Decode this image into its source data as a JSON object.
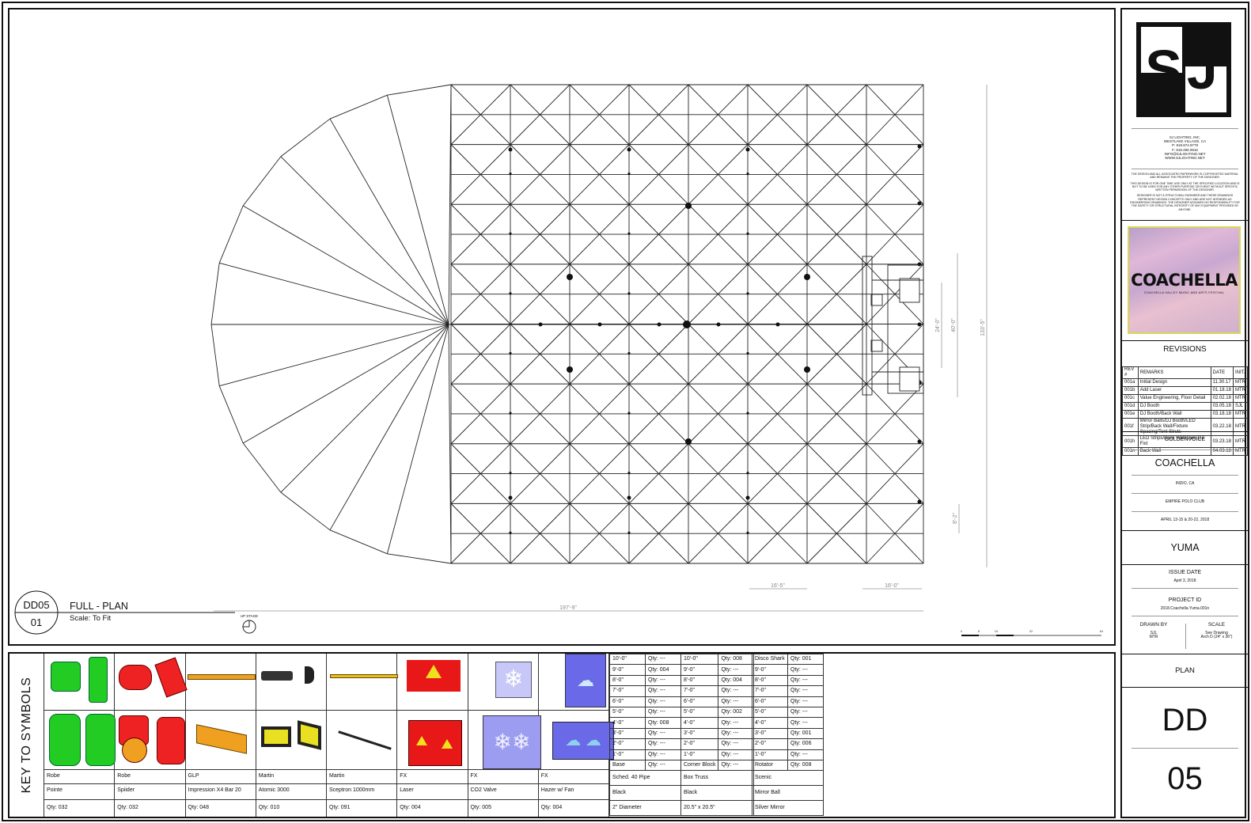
{
  "drawing": {
    "sheet_code": "DD05",
    "sheet_num": "01",
    "view_title": "FULL - PLAN",
    "scale_note": "Scale: To Fit",
    "upstage_label": "UP STAGE",
    "dims": {
      "overall_width": "197'-9\"",
      "overall_depth": "133'-5\"",
      "booth_a": "24'-0\"",
      "booth_b": "40'-0\"",
      "side": "8'-2\"",
      "bottom_a": "16'-5\"",
      "bottom_b": "16'-0\""
    },
    "scale_bar": [
      "0",
      "8",
      "16",
      "32",
      "64"
    ]
  },
  "titleblock": {
    "logo": "SJ",
    "company": [
      "SJ LIGHTING, INC.",
      "WESTLAKE VILLAGE, CA",
      "P: 818.874.9779",
      "F: 818.495.0816",
      "INFO@SJLIGHTING.NET",
      "WWW.SJLIGHTING.NET"
    ],
    "legal": [
      "THE DESIGN AND ALL ASSOCIATED PAPERWORK IS COPYRIGHTED MATERIAL AND REMAINS THE PROPERTY OF THE DESIGNER.",
      "THIS DESIGN IS FOR ONE TIME USE ONLY AT THE SPECIFIED LOCATION AND IS NOT TO BE USED FOR ANY OTHER PURPOSE OR EVENT WITHOUT SPECIFIC WRITTEN PERMISSION OF THE DESIGNER.",
      "DESIGNER IS NOT A STRUCTURAL ENGINEER AND THESE DRAWINGS REPRESENT DESIGN CONCEPTS ONLY AND ARE NOT INTENDED AS ENGINEERING DRAWINGS. THE DESIGNER ASSUMES NO RESPONSIBILITY FOR THE SAFETY OR STRUCTURAL INTEGRITY OF ANY EQUIPMENT PROVIDED BY ANYONE."
    ],
    "festival_logo": "COACHELLA",
    "festival_sub": "COACHELLA VALLEY MUSIC AND ARTS FESTIVAL",
    "revisions_title": "REVISIONS",
    "rev_headers": [
      "REV #",
      "REMARKS",
      "DATE",
      "INIT."
    ],
    "revisions": [
      [
        "001a",
        "Initial Design",
        "11.30.17",
        "MTR"
      ],
      [
        "001b",
        "Add Laser",
        "01.18.18",
        "MTR"
      ],
      [
        "001c",
        "Value Engineering, Floor Detail",
        "02.02.18",
        "MTR"
      ],
      [
        "001d",
        "DJ Booth",
        "03.05.18",
        "SJL"
      ],
      [
        "001e",
        "DJ Booth/Back Wall",
        "03.18.18",
        "MTR"
      ],
      [
        "001f",
        "Mirror Balls/DJ Booth/LED Strip/Back Wall/Fixture Spacing/Tent Struts",
        "03.22.18",
        "MTR"
      ],
      [
        "001h",
        "LED Strips/Back Wall/Over DJ Fixt",
        "03.23.18",
        "MTR"
      ],
      [
        "001n",
        "Back Wall",
        "04.03.18",
        "MTR"
      ]
    ],
    "client": "GOLDENVOICE",
    "event": "COACHELLA",
    "city": "INDIO, CA",
    "venue": "EMPIRE POLO CLUB",
    "dates": "APRIL 13-15 & 20-22, 2018",
    "stage": "YUMA",
    "issue_label": "ISSUE DATE",
    "issue_date": "April 3, 2018",
    "project_label": "PROJECT ID",
    "project_id": "2018.Coachella.Yuma.001n",
    "drawn_label": "DRAWN BY",
    "drawn_by": [
      "SJL",
      "MTR"
    ],
    "scale_label": "SCALE",
    "scale_value": [
      "See Drawing",
      "Arch D (24\" x 36\")"
    ],
    "sheet_type": "PLAN",
    "sheet_letters": "DD",
    "sheet_number": "05"
  },
  "key": {
    "title": "KEY TO SYMBOLS",
    "fixtures": [
      {
        "mfr": "Robe",
        "model": "Pointe",
        "qty": "Qty: 032",
        "color": "#22cc22"
      },
      {
        "mfr": "Robe",
        "model": "Spiider",
        "qty": "Qty: 032",
        "color": "#ee2222"
      },
      {
        "mfr": "GLP",
        "model": "Impression X4 Bar 20",
        "qty": "Qty: 048",
        "color": "#f0a020"
      },
      {
        "mfr": "Martin",
        "model": "Atomic 3000",
        "qty": "Qty: 010",
        "color": "#e8e020"
      },
      {
        "mfr": "Martin",
        "model": "Sceptron 1000mm",
        "qty": "Qty: 091",
        "color": "#e8c020"
      },
      {
        "mfr": "FX",
        "model": "Laser",
        "qty": "Qty: 004",
        "color": "#e81818"
      },
      {
        "mfr": "FX",
        "model": "CO2 Valve",
        "qty": "Qty: 005",
        "color": "#9c9cf0"
      },
      {
        "mfr": "FX",
        "model": "Hazer w/ Fan",
        "qty": "Qty: 004",
        "color": "#6a6ae8"
      }
    ],
    "pipe": {
      "rows": [
        [
          "10'-0\"",
          "Qty: ---"
        ],
        [
          "9'-0\"",
          "Qty: 004"
        ],
        [
          "8'-0\"",
          "Qty: ---"
        ],
        [
          "7'-0\"",
          "Qty: ---"
        ],
        [
          "6'-0\"",
          "Qty: ---"
        ],
        [
          "5'-0\"",
          "Qty: ---"
        ],
        [
          "4'-0\"",
          "Qty: 008"
        ],
        [
          "3'-0\"",
          "Qty: ---"
        ],
        [
          "2'-0\"",
          "Qty: ---"
        ],
        [
          "1'-0\"",
          "Qty: ---"
        ],
        [
          "Base",
          "Qty: ---"
        ]
      ],
      "name": "Sched. 40 Pipe",
      "finish": "Black",
      "size": "2\" Diameter"
    },
    "truss": {
      "rows": [
        [
          "10'-0\"",
          "Qty: 008"
        ],
        [
          "9'-0\"",
          "Qty: ---"
        ],
        [
          "8'-0\"",
          "Qty: 004"
        ],
        [
          "7'-0\"",
          "Qty: ---"
        ],
        [
          "6'-0\"",
          "Qty: ---"
        ],
        [
          "5'-0\"",
          "Qty: 002"
        ],
        [
          "4'-0\"",
          "Qty: ---"
        ],
        [
          "3'-0\"",
          "Qty: ---"
        ],
        [
          "2'-0\"",
          "Qty: ---"
        ],
        [
          "1'-0\"",
          "Qty: ---"
        ],
        [
          "Corner Block",
          "Qty: ---"
        ]
      ],
      "name": "Box Truss",
      "finish": "Black",
      "size": "20.5\" x 20.5\""
    },
    "scenic": {
      "rows": [
        [
          "Disco Shark",
          "Qty: 001"
        ],
        [
          "9'-0\"",
          "Qty: ---"
        ],
        [
          "8'-0\"",
          "Qty: ---"
        ],
        [
          "7'-0\"",
          "Qty: ---"
        ],
        [
          "6'-0\"",
          "Qty: ---"
        ],
        [
          "5'-0\"",
          "Qty: ---"
        ],
        [
          "4'-0\"",
          "Qty: ---"
        ],
        [
          "3'-0\"",
          "Qty: 001"
        ],
        [
          "2'-0\"",
          "Qty: 006"
        ],
        [
          "1'-0\"",
          "Qty: ---"
        ],
        [
          "Rotator",
          "Qty: 008"
        ]
      ],
      "name": "Scenic",
      "finish": "Mirror Ball",
      "size": "Silver Mirror"
    }
  }
}
